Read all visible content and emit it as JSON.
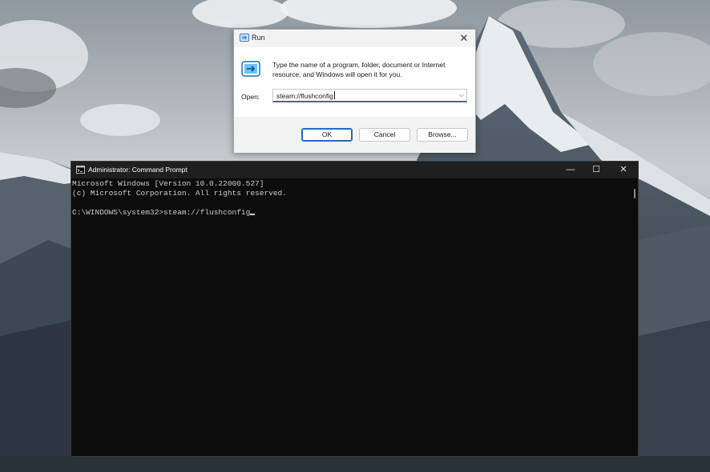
{
  "run_dialog": {
    "title": "Run",
    "close_glyph": "✕",
    "description": "Type the name of a program, folder, document or Internet resource, and Windows will open it for you.",
    "open_label": "Open:",
    "open_value": "steam://flushconfig",
    "dropdown_glyph": "⌵",
    "buttons": {
      "ok": "OK",
      "cancel": "Cancel",
      "browse": "Browse..."
    },
    "icon": "run-icon",
    "accent_color": "#1b6ec2"
  },
  "cmd_window": {
    "title": "Administrator: Command Prompt",
    "icon": "cmd-icon",
    "controls": {
      "minimize": "—",
      "maximize": "☐",
      "close": "✕"
    },
    "lines": [
      "Microsoft Windows [Version 10.0.22000.527]",
      "(c) Microsoft Corporation. All rights reserved.",
      "",
      "C:\\WINDOWS\\system32>steam://flushconfig"
    ],
    "background_color": "#0c0c0c",
    "text_color": "#cccccc"
  },
  "desktop": {
    "wallpaper": "mountain-landscape"
  }
}
